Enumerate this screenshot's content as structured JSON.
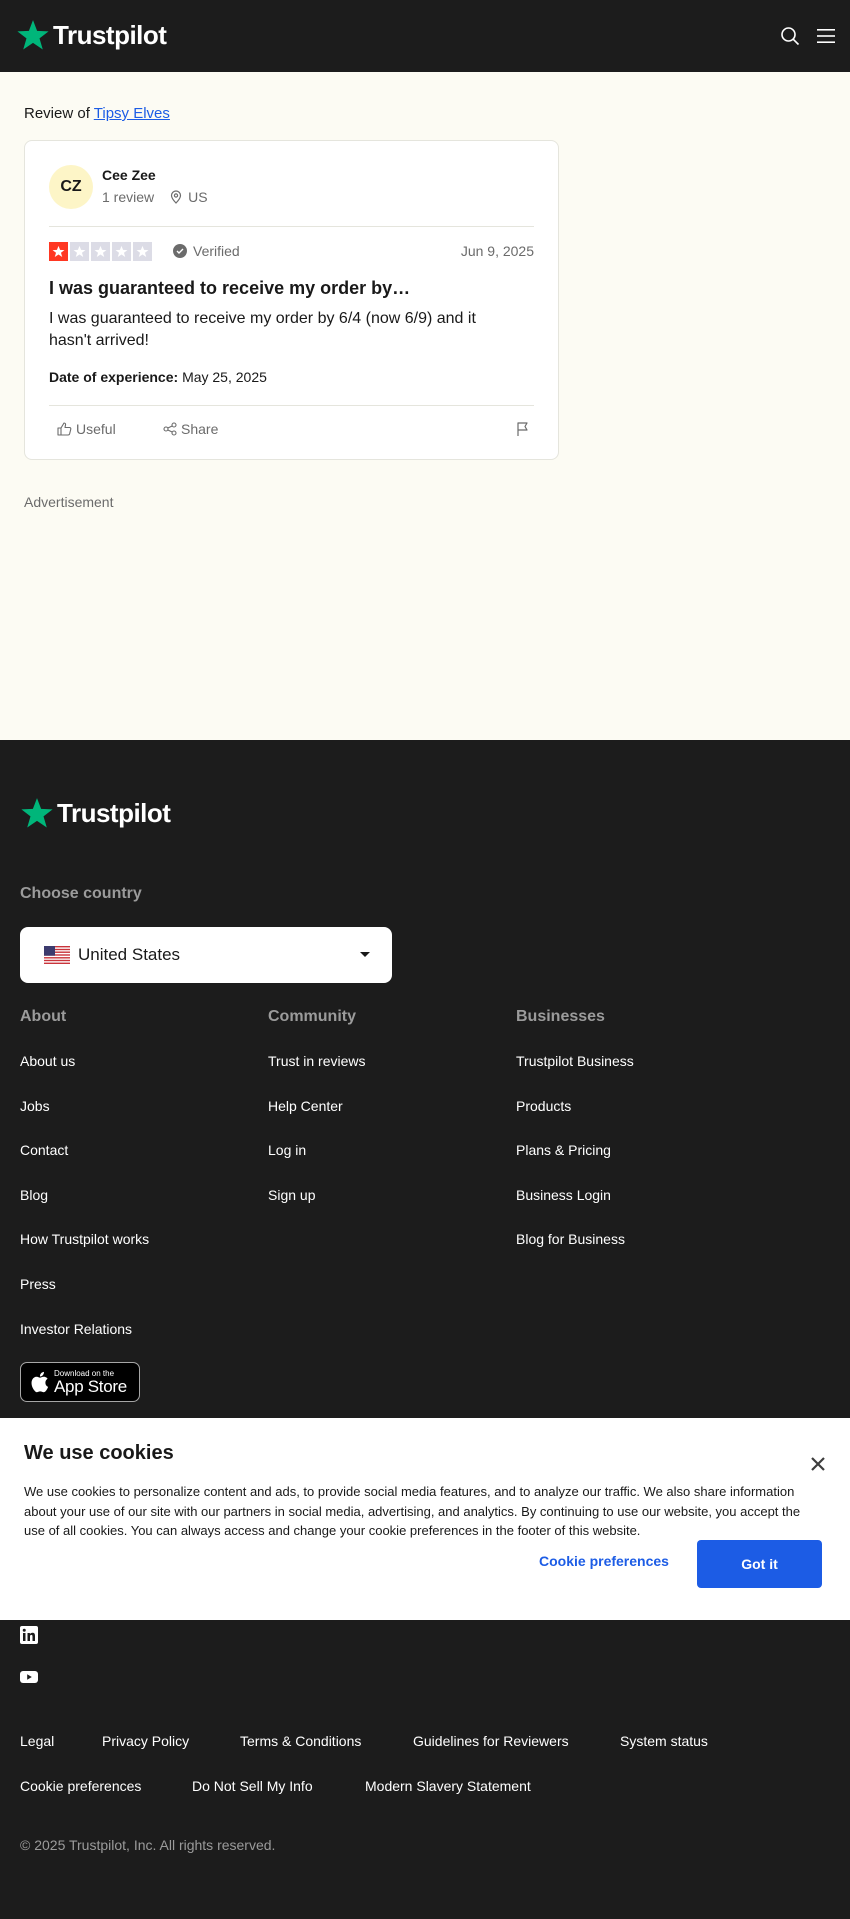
{
  "header": {
    "brand": "Trustpilot",
    "search_icon": "search-icon",
    "menu_icon": "menu-icon"
  },
  "review_of": {
    "prefix": "Review of",
    "company": "Tipsy Elves"
  },
  "review": {
    "initials": "CZ",
    "reviewer_name": "Cee Zee",
    "review_count": "1 review",
    "location": "US",
    "rating": 1,
    "verified": "Verified",
    "date": "Jun 9, 2025",
    "title": "I was guaranteed to receive my order by…",
    "body": "I was guaranteed to receive my order by 6/4 (now 6/9) and it hasn't arrived!",
    "experience_label": "Date of experience:",
    "experience_date": "May 25, 2025",
    "useful_label": "Useful",
    "share_label": "Share"
  },
  "advertisement_label": "Advertisement",
  "footer": {
    "brand": "Trustpilot",
    "choose_country": "Choose country",
    "country": "United States",
    "columns": [
      {
        "title": "About",
        "links": [
          "About us",
          "Jobs",
          "Contact",
          "Blog",
          "How Trustpilot works",
          "Press",
          "Investor Relations"
        ]
      },
      {
        "title": "Community",
        "links": [
          "Trust in reviews",
          "Help Center",
          "Log in",
          "Sign up"
        ]
      },
      {
        "title": "Businesses",
        "links": [
          "Trustpilot Business",
          "Products",
          "Plans & Pricing",
          "Business Login",
          "Blog for Business"
        ]
      }
    ],
    "app_store": {
      "small": "Download on the",
      "big": "App Store"
    },
    "bottom_links_row1": [
      "Legal",
      "Privacy Policy",
      "Terms & Conditions",
      "Guidelines for Reviewers",
      "System status"
    ],
    "bottom_links_row2": [
      "Cookie preferences",
      "Do Not Sell My Info",
      "Modern Slavery Statement"
    ],
    "copyright": "© 2025 Trustpilot, Inc. All rights reserved."
  },
  "cookie_banner": {
    "title": "We use cookies",
    "text": "We use cookies to personalize content and ads, to provide social media features, and to analyze our traffic. We also share information about your use of our site with our partners in social media, advertising, and analytics. By continuing to use our website, you accept the use of all cookies. You can always access and change your cookie preferences in the footer of this website.",
    "preferences_label": "Cookie preferences",
    "accept_label": "Got it"
  },
  "colors": {
    "brand_green": "#00b67a",
    "star_red": "#ff3722",
    "link_blue": "#1c5ce5",
    "dark_bg": "#1c1c1c",
    "page_bg": "#fcfbf3"
  }
}
